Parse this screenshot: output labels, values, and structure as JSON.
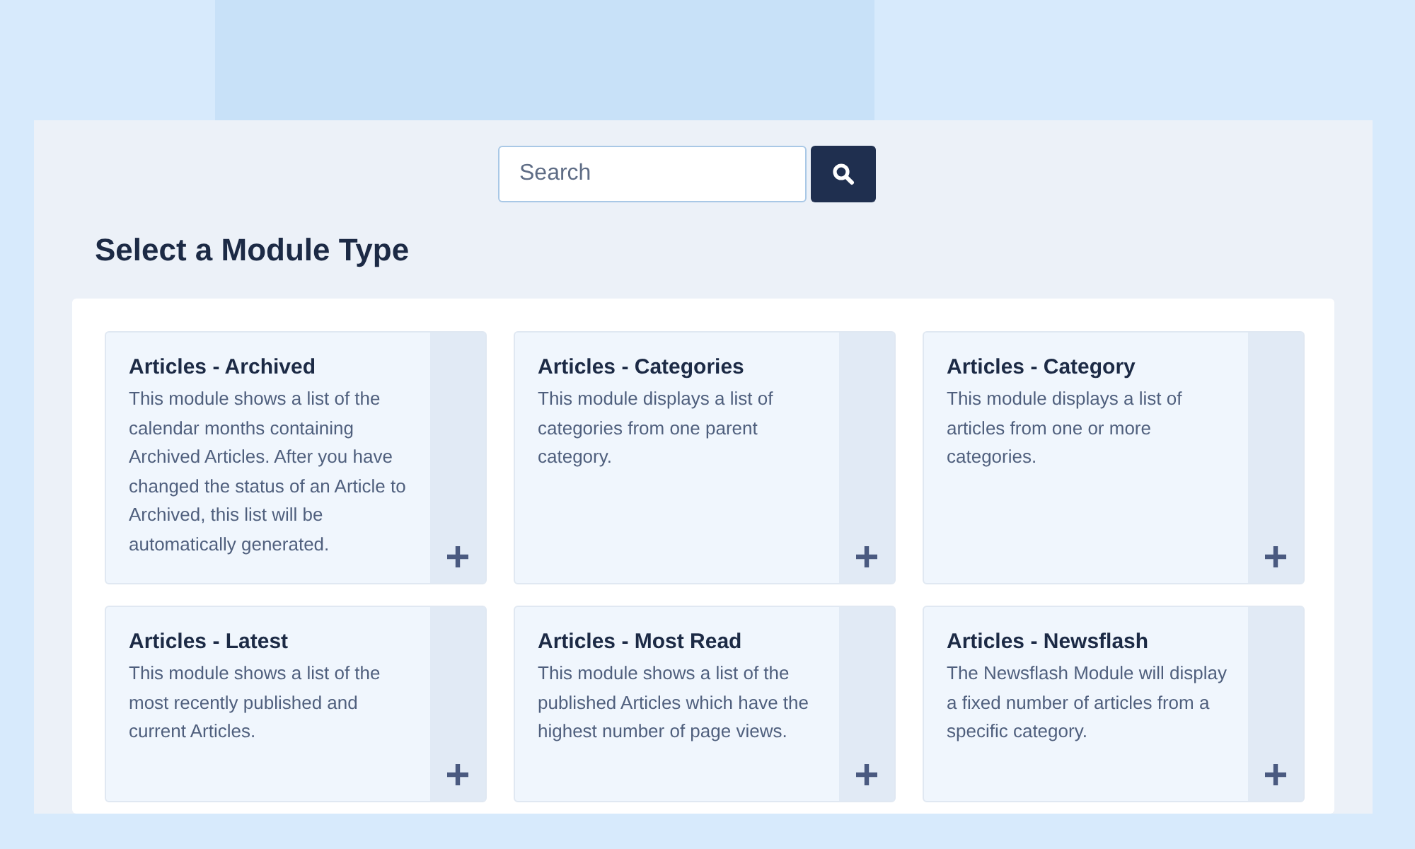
{
  "search": {
    "placeholder": "Search"
  },
  "heading": "Select a Module Type",
  "modules": [
    {
      "title": "Articles - Archived",
      "description": "This module shows a list of the calendar months containing Archived Articles. After you have changed the status of an Article to Archived, this list will be automatically generated."
    },
    {
      "title": "Articles - Categories",
      "description": "This module displays a list of categories from one parent category."
    },
    {
      "title": "Articles - Category",
      "description": "This module displays a list of articles from one or more categories."
    },
    {
      "title": "Articles - Latest",
      "description": "This module shows a list of the most recently published and current Articles."
    },
    {
      "title": "Articles - Most Read",
      "description": "This module shows a list of the published Articles which have the highest number of page views."
    },
    {
      "title": "Articles - Newsflash",
      "description": "The Newsflash Module will display a fixed number of articles from a specific category."
    }
  ]
}
